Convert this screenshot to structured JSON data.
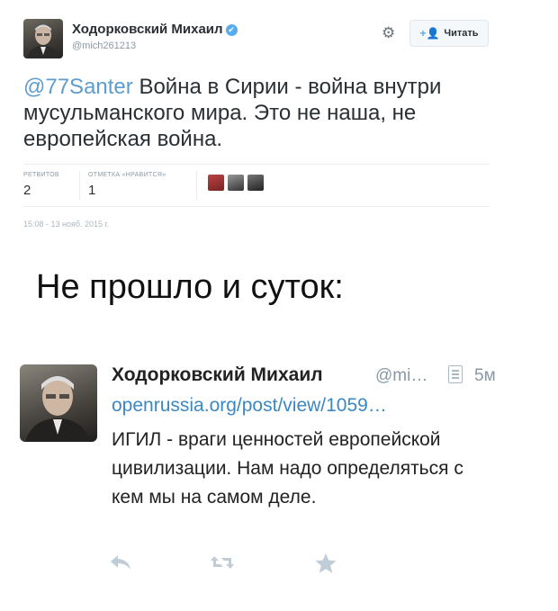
{
  "tweet1": {
    "name": "Ходорковский Михаил",
    "verified_icon": "✔",
    "handle": "@mich261213",
    "follow_label": "Читать",
    "mention": "@77Santer",
    "text": " Война в Сирии - война внутри мусульманского мира. Это не наша, не европейская война.",
    "retweets_label": "РЕТВИТОВ",
    "retweets_count": "2",
    "likes_label": "ОТМЕТКА «НРАВИТСЯ»",
    "likes_count": "1",
    "timestamp": "15:08 - 13 нояб. 2015 г."
  },
  "caption": "Не прошло и суток:",
  "tweet2": {
    "name": "Ходорковский Михаил",
    "handle": "@mi…",
    "time": "5м",
    "link": "openrussia.org/post/view/1059…",
    "text": "ИГИЛ - враги ценностей европейской цивилизации. Нам надо определяться с кем мы на самом деле."
  },
  "colors": {
    "accent_blue": "#55acee",
    "link_blue": "#3b88c3",
    "muted_gray": "#8899a6"
  },
  "icons": {
    "gear": "gear-icon",
    "follow": "add-user-icon",
    "reply": "reply-icon",
    "retweet": "retweet-icon",
    "favorite": "star-icon"
  }
}
